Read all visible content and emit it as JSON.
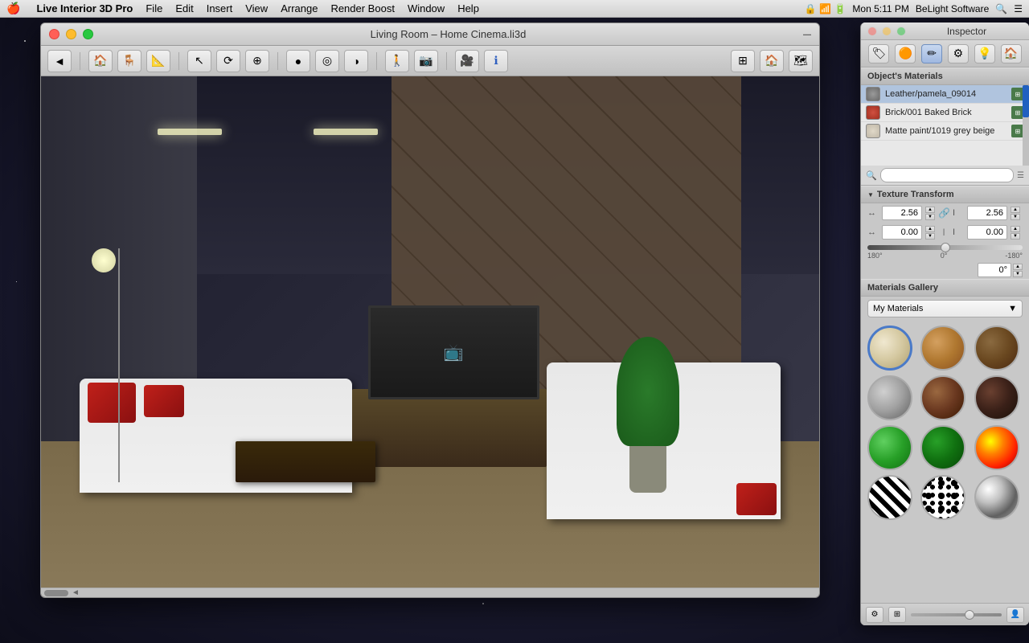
{
  "menubar": {
    "apple": "🍎",
    "app_name": "Live Interior 3D Pro",
    "menus": [
      "File",
      "Edit",
      "Insert",
      "View",
      "Arrange",
      "Render Boost",
      "Window",
      "Help"
    ],
    "right_time": "Mon 5:11 PM",
    "right_company": "BeLight Software"
  },
  "main_window": {
    "title": "Living Room – Home Cinema.li3d",
    "traffic_lights": [
      "close",
      "minimize",
      "maximize"
    ]
  },
  "toolbar": {
    "back_label": "◄",
    "tools": [
      "🏠",
      "🪑",
      "📐",
      "↖",
      "⟳",
      "⊕",
      "●",
      "◎",
      "◑",
      "📷",
      "🎥",
      "ℹ",
      "⊞",
      "🏠",
      "🗺"
    ]
  },
  "inspector": {
    "title": "Inspector",
    "traffic_lights": [
      "close",
      "minimize",
      "maximize"
    ],
    "tabs": [
      {
        "icon": "🏷",
        "label": "info"
      },
      {
        "icon": "🟠",
        "label": "object"
      },
      {
        "icon": "✏",
        "label": "materials"
      },
      {
        "icon": "⚙",
        "label": "settings"
      },
      {
        "icon": "💡",
        "label": "lights"
      },
      {
        "icon": "🏠",
        "label": "room"
      }
    ],
    "objects_materials": {
      "section_title": "Object's Materials",
      "materials": [
        {
          "name": "Leather/pamela_09014",
          "swatch_color": "#7a7a7a",
          "icon": "grid"
        },
        {
          "name": "Brick/001 Baked Brick",
          "swatch_color": "#c04030",
          "icon": "grid"
        },
        {
          "name": "Matte paint/1019 grey beige",
          "swatch_color": "#d8d0c0",
          "icon": "grid"
        }
      ]
    },
    "texture_transform": {
      "section_title": "Texture Transform",
      "width_value": "2.56",
      "height_value": "2.56",
      "offset_x": "0.00",
      "offset_y": "0.00",
      "rotation_value": "0°",
      "rotation_labels": {
        "left": "180°",
        "center": "0°",
        "right": "-180°"
      }
    },
    "materials_gallery": {
      "section_title": "Materials Gallery",
      "dropdown_value": "My Materials",
      "swatches": [
        {
          "id": "beige",
          "class": "sw-beige",
          "label": "Beige fabric"
        },
        {
          "id": "wood-light",
          "class": "sw-wood-light",
          "label": "Light wood"
        },
        {
          "id": "wood-brick",
          "class": "sw-wood-dark",
          "label": "Dark wood"
        },
        {
          "id": "metal",
          "class": "sw-metal",
          "label": "Metal"
        },
        {
          "id": "brown",
          "class": "sw-brown",
          "label": "Brown wood"
        },
        {
          "id": "darkbrown",
          "class": "sw-darkbrown",
          "label": "Dark brown"
        },
        {
          "id": "green",
          "class": "sw-green",
          "label": "Green"
        },
        {
          "id": "dkgreen",
          "class": "sw-dkgreen",
          "label": "Dark green"
        },
        {
          "id": "fire",
          "class": "sw-fire",
          "label": "Fire"
        },
        {
          "id": "zebra",
          "class": "sw-zebra",
          "label": "Zebra"
        },
        {
          "id": "spots",
          "class": "sw-spots",
          "label": "Spots"
        },
        {
          "id": "chrome",
          "class": "sw-chrome",
          "label": "Chrome"
        }
      ]
    }
  }
}
